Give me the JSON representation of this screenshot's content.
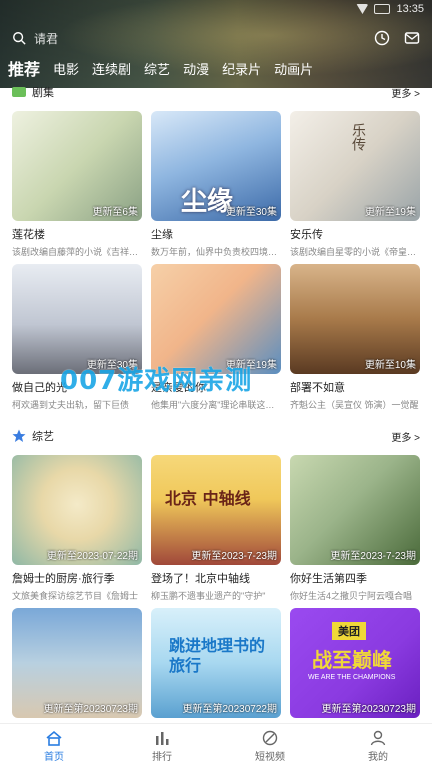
{
  "statusbar": {
    "time": "13:35"
  },
  "search": {
    "placeholder": "请君"
  },
  "tabs": [
    {
      "label": "推荐",
      "active": true
    },
    {
      "label": "电影"
    },
    {
      "label": "连续剧"
    },
    {
      "label": "综艺"
    },
    {
      "label": "动漫"
    },
    {
      "label": "纪录片"
    },
    {
      "label": "动画片"
    }
  ],
  "sections": [
    {
      "title": "剧集",
      "more": "更多 >",
      "cards": [
        {
          "title": "莲花楼",
          "desc": "该剧改编自藤萍的小说《吉祥纹莲花楼》",
          "badge": "更新至6集",
          "colors": [
            "#cfd8b8",
            "#8aa184"
          ]
        },
        {
          "title": "尘缘",
          "desc": "数万年前，仙界中负责校四境功德",
          "badge": "更新至30集",
          "colors": [
            "#8fb6e0",
            "#3c6aa8"
          ]
        },
        {
          "title": "安乐传",
          "desc": "该剧改编自星零的小说《帝皇书》",
          "badge": "更新至19集",
          "colors": [
            "#e7e3dc",
            "#9aa4a8"
          ]
        },
        {
          "title": "做自己的光",
          "desc": "柯欢遇到丈夫出轨，留下巨债",
          "badge": "更新至30集",
          "colors": [
            "#d8dde6",
            "#6b6e78"
          ]
        },
        {
          "title": "是亲爱的你",
          "desc": "他集用\"六度分离\"理论串联这三个",
          "badge": "更新至19集",
          "colors": [
            "#f1b58a",
            "#5a8ec0"
          ]
        },
        {
          "title": "部署不如意",
          "desc": "齐魁公主（吴宣仪 饰演）一觉醒",
          "badge": "更新至10集",
          "colors": [
            "#c9a27a",
            "#5a3a22"
          ]
        }
      ]
    },
    {
      "title": "综艺",
      "more": "更多 >",
      "cards": [
        {
          "title": "詹姆士的厨房·旅行季",
          "desc": "文旅美食探访综艺节目《詹姆士",
          "badge": "更新至2023-07-22期",
          "colors": [
            "#e8d8a8",
            "#8fb8a6"
          ]
        },
        {
          "title": "登场了！北京中轴线",
          "desc": "柳玉鹏不遗事业遗产的\"守护\"",
          "badge": "更新至2023-7-23期",
          "colors": [
            "#f0c85a",
            "#a0483a"
          ]
        },
        {
          "title": "你好生活第四季",
          "desc": "你好生活4之撒贝宁阿云嘎合唱",
          "badge": "更新至2023-7-23期",
          "colors": [
            "#9bb48a",
            "#4a6a3a"
          ]
        },
        {
          "title": "",
          "desc": "",
          "badge": "更新至第20230723期",
          "colors": [
            "#7aa8d8",
            "#d8c8b0"
          ]
        },
        {
          "title": "",
          "desc": "",
          "badge": "更新至第20230722期",
          "colors": [
            "#a8d8f0",
            "#5aa0d0"
          ]
        },
        {
          "title": "",
          "desc": "",
          "badge": "更新至第20230723期",
          "colors": [
            "#8a3ae0",
            "#e8d84a"
          ]
        }
      ]
    }
  ],
  "poster_texts": {
    "c2": "尘缘",
    "c3": "乐传",
    "v2": "北京 中轴线",
    "v5": "跳进地理书的旅行",
    "v6a": "美团",
    "v6b": "战至巅峰",
    "v6c": "WE ARE THE CHAMPIONS"
  },
  "watermark": "007游戏网亲测",
  "bottomnav": [
    {
      "label": "首页",
      "active": true
    },
    {
      "label": "排行"
    },
    {
      "label": "短视频"
    },
    {
      "label": "我的"
    }
  ]
}
